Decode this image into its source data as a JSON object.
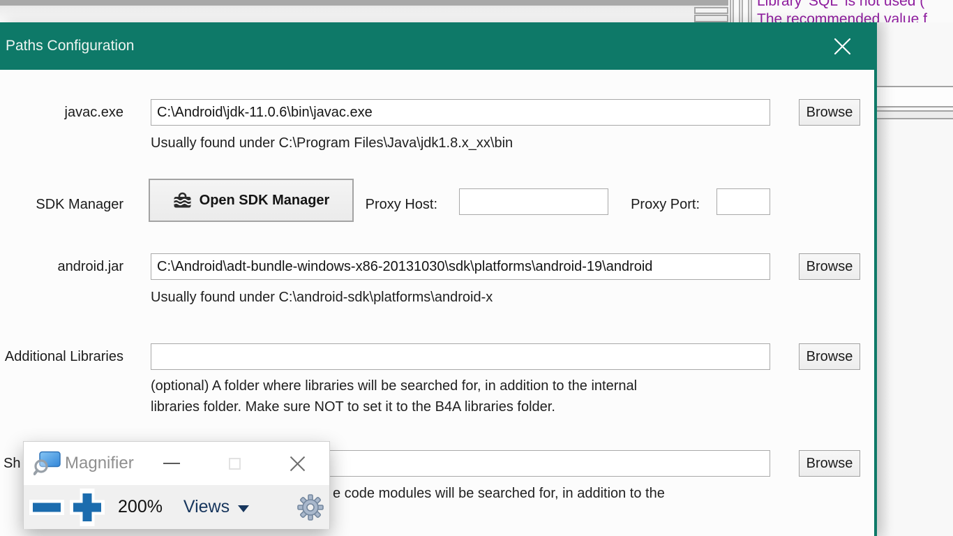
{
  "colors": {
    "accent_teal": "#0e7968",
    "warning_purple": "#8e1d9e",
    "magnifier_blue": "#1b6cae",
    "views_navy": "#17365d"
  },
  "background": {
    "warning_line1": "Library 'SQL' is not used (",
    "warning_line2": "The recommended value f"
  },
  "dialog": {
    "title": "Paths Configuration",
    "browse_label": "Browse",
    "javac": {
      "label": "javac.exe",
      "value": "C:\\Android\\jdk-11.0.6\\bin\\javac.exe",
      "helper": "Usually found under C:\\Program Files\\Java\\jdk1.8.x_xx\\bin"
    },
    "sdk": {
      "label": "SDK Manager",
      "button_label": "Open SDK Manager",
      "proxy_host_label": "Proxy Host:",
      "proxy_host_value": "",
      "proxy_port_label": "Proxy Port:",
      "proxy_port_value": ""
    },
    "android_jar": {
      "label": "android.jar",
      "value": "C:\\Android\\adt-bundle-windows-x86-20131030\\sdk\\platforms\\android-19\\android",
      "helper": "Usually found under C:\\android-sdk\\platforms\\android-x"
    },
    "libraries": {
      "label": "Additional Libraries",
      "value": "",
      "helper_line1": "(optional) A folder where libraries will be searched for, in addition to the internal",
      "helper_line2": "libraries folder. Make sure NOT to set it to the B4A libraries folder."
    },
    "shared": {
      "label_visible": "Sh",
      "value": "",
      "helper_visible": "e code modules will be searched for, in addition to the"
    }
  },
  "magnifier": {
    "title": "Magnifier",
    "zoom_level": "200%",
    "views_label": "Views",
    "icons": {
      "app_icon": "magnifying-glass-over-screen",
      "zoom_out": "minus",
      "zoom_in": "plus",
      "settings": "gear",
      "views_caret": "chevron-down"
    }
  }
}
